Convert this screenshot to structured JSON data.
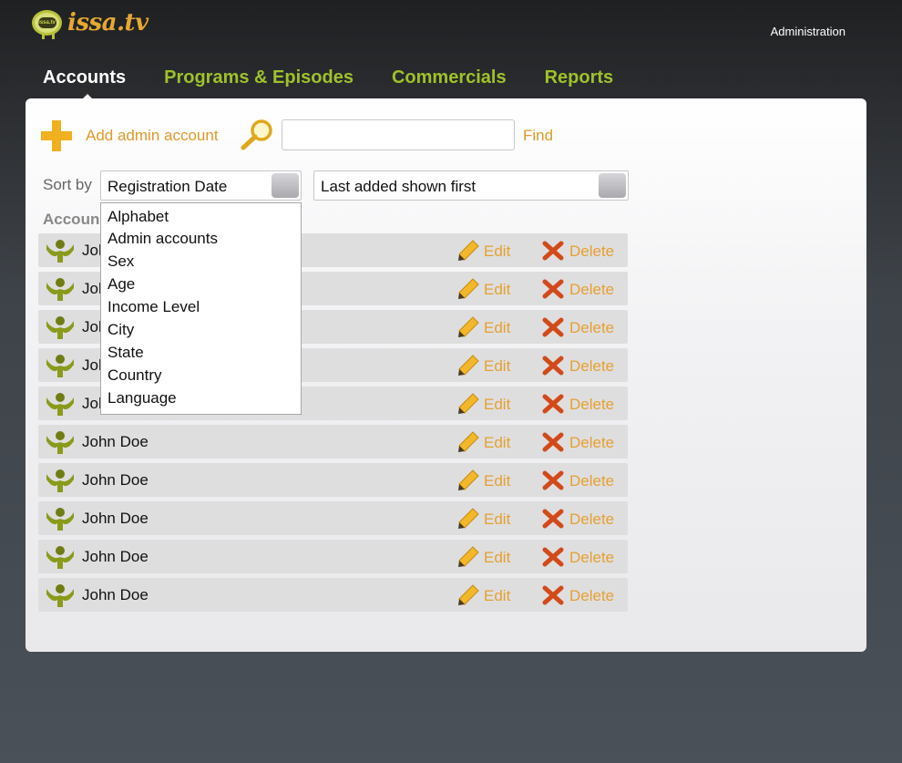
{
  "brand": {
    "name": "issa.tv",
    "badge": "issa.tv"
  },
  "header": {
    "admin_link": "Administration"
  },
  "nav": [
    {
      "label": "Accounts",
      "active": true
    },
    {
      "label": "Programs & Episodes",
      "active": false
    },
    {
      "label": "Commercials",
      "active": false
    },
    {
      "label": "Reports",
      "active": false
    }
  ],
  "toolbar": {
    "add_label": "Add admin account",
    "search_value": "",
    "find_label": "Find"
  },
  "sort": {
    "label": "Sort by",
    "selected_field": "Registration Date",
    "selected_order": "Last added shown first",
    "options": [
      "Alphabet",
      "Admin accounts",
      "Sex",
      "Age",
      "Income Level",
      "City",
      "State",
      "Country",
      "Language"
    ]
  },
  "list": {
    "heading": "Accoun",
    "edit_label": "Edit",
    "delete_label": "Delete",
    "rows": [
      {
        "name": "John Doe"
      },
      {
        "name": "John Doe"
      },
      {
        "name": "John Doe"
      },
      {
        "name": "John Doe"
      },
      {
        "name": "John Doe"
      },
      {
        "name": "John Doe"
      },
      {
        "name": "John Doe"
      },
      {
        "name": "John Doe"
      },
      {
        "name": "John Doe"
      },
      {
        "name": "John Doe"
      }
    ]
  },
  "colors": {
    "accent_orange": "#e09a28",
    "nav_green": "#9ec22a",
    "row_bg": "#dededf"
  },
  "icons": {
    "add": "plus-icon",
    "search": "magnifier-icon",
    "user": "user-icon",
    "edit": "pencil-icon",
    "delete": "x-icon"
  }
}
